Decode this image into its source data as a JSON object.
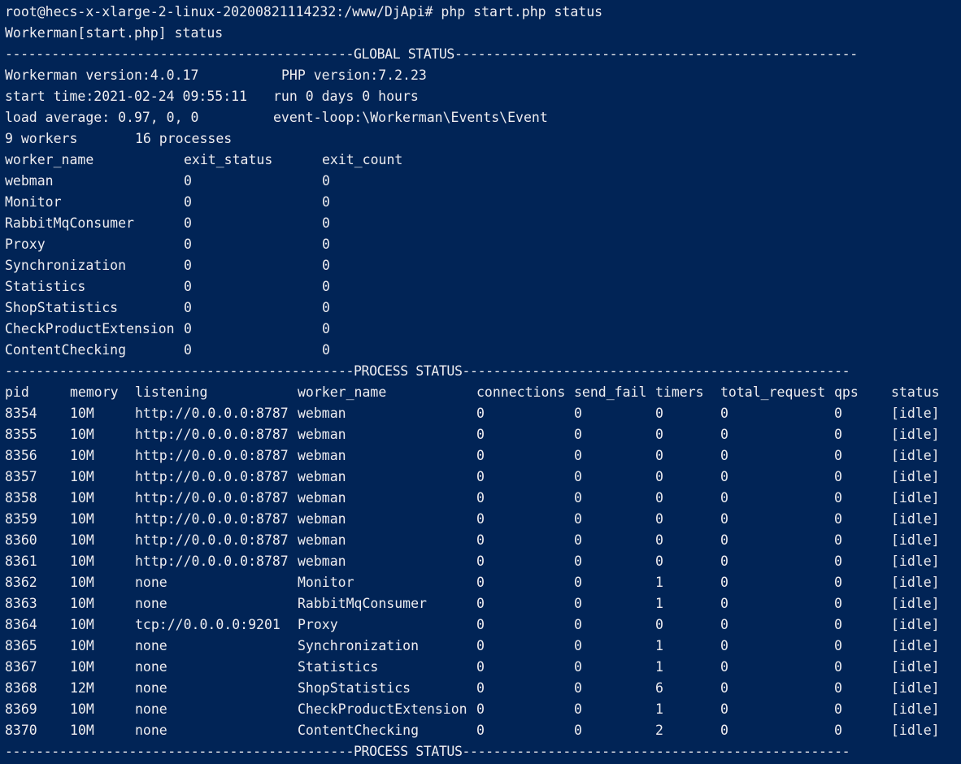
{
  "terminal": {
    "prompt_line": "root@hecs-x-xlarge-2-linux-20200821114232:/www/DjApi# php start.php status",
    "header_line": "Workerman[start.php] status",
    "global_separator": "---------------------------------------------GLOBAL STATUS----------------------------------------------------",
    "global": {
      "workerman_version": "Workerman version:4.0.17",
      "php_version": "PHP version:7.2.23",
      "start_time": "start time:2021-02-24 09:55:11",
      "run_time": "run 0 days 0 hours",
      "load_average": "load average: 0.97, 0, 0",
      "event_loop": "event-loop:\\Workerman\\Events\\Event",
      "workers": "9 workers",
      "processes": "16 processes"
    },
    "worker_headers": [
      "worker_name",
      "exit_status",
      "exit_count"
    ],
    "workers": [
      [
        "webman",
        "0",
        "0"
      ],
      [
        "Monitor",
        "0",
        "0"
      ],
      [
        "RabbitMqConsumer",
        "0",
        "0"
      ],
      [
        "Proxy",
        "0",
        "0"
      ],
      [
        "Synchronization",
        "0",
        "0"
      ],
      [
        "Statistics",
        "0",
        "0"
      ],
      [
        "ShopStatistics",
        "0",
        "0"
      ],
      [
        "CheckProductExtension",
        "0",
        "0"
      ],
      [
        "ContentChecking",
        "0",
        "0"
      ]
    ],
    "process_separator": "---------------------------------------------PROCESS STATUS--------------------------------------------------",
    "process_headers": [
      "pid",
      "memory",
      "listening",
      "worker_name",
      "connections",
      "send_fail",
      "timers",
      "total_request",
      "qps",
      "status"
    ],
    "processes": [
      [
        "8354",
        "10M",
        "http://0.0.0.0:8787",
        "webman",
        "0",
        "0",
        "0",
        "0",
        "0",
        "[idle]"
      ],
      [
        "8355",
        "10M",
        "http://0.0.0.0:8787",
        "webman",
        "0",
        "0",
        "0",
        "0",
        "0",
        "[idle]"
      ],
      [
        "8356",
        "10M",
        "http://0.0.0.0:8787",
        "webman",
        "0",
        "0",
        "0",
        "0",
        "0",
        "[idle]"
      ],
      [
        "8357",
        "10M",
        "http://0.0.0.0:8787",
        "webman",
        "0",
        "0",
        "0",
        "0",
        "0",
        "[idle]"
      ],
      [
        "8358",
        "10M",
        "http://0.0.0.0:8787",
        "webman",
        "0",
        "0",
        "0",
        "0",
        "0",
        "[idle]"
      ],
      [
        "8359",
        "10M",
        "http://0.0.0.0:8787",
        "webman",
        "0",
        "0",
        "0",
        "0",
        "0",
        "[idle]"
      ],
      [
        "8360",
        "10M",
        "http://0.0.0.0:8787",
        "webman",
        "0",
        "0",
        "0",
        "0",
        "0",
        "[idle]"
      ],
      [
        "8361",
        "10M",
        "http://0.0.0.0:8787",
        "webman",
        "0",
        "0",
        "0",
        "0",
        "0",
        "[idle]"
      ],
      [
        "8362",
        "10M",
        "none",
        "Monitor",
        "0",
        "0",
        "1",
        "0",
        "0",
        "[idle]"
      ],
      [
        "8363",
        "10M",
        "none",
        "RabbitMqConsumer",
        "0",
        "0",
        "1",
        "0",
        "0",
        "[idle]"
      ],
      [
        "8364",
        "10M",
        "tcp://0.0.0.0:9201",
        "Proxy",
        "0",
        "0",
        "0",
        "0",
        "0",
        "[idle]"
      ],
      [
        "8365",
        "10M",
        "none",
        "Synchronization",
        "0",
        "0",
        "1",
        "0",
        "0",
        "[idle]"
      ],
      [
        "8367",
        "10M",
        "none",
        "Statistics",
        "0",
        "0",
        "1",
        "0",
        "0",
        "[idle]"
      ],
      [
        "8368",
        "12M",
        "none",
        "ShopStatistics",
        "0",
        "0",
        "6",
        "0",
        "0",
        "[idle]"
      ],
      [
        "8369",
        "10M",
        "none",
        "CheckProductExtension",
        "0",
        "0",
        "1",
        "0",
        "0",
        "[idle]"
      ],
      [
        "8370",
        "10M",
        "none",
        "ContentChecking",
        "0",
        "0",
        "2",
        "0",
        "0",
        "[idle]"
      ]
    ],
    "footer_separator": "---------------------------------------------PROCESS STATUS--------------------------------------------------"
  },
  "colors": {
    "background": "#012456",
    "foreground": "#eeedf0"
  }
}
